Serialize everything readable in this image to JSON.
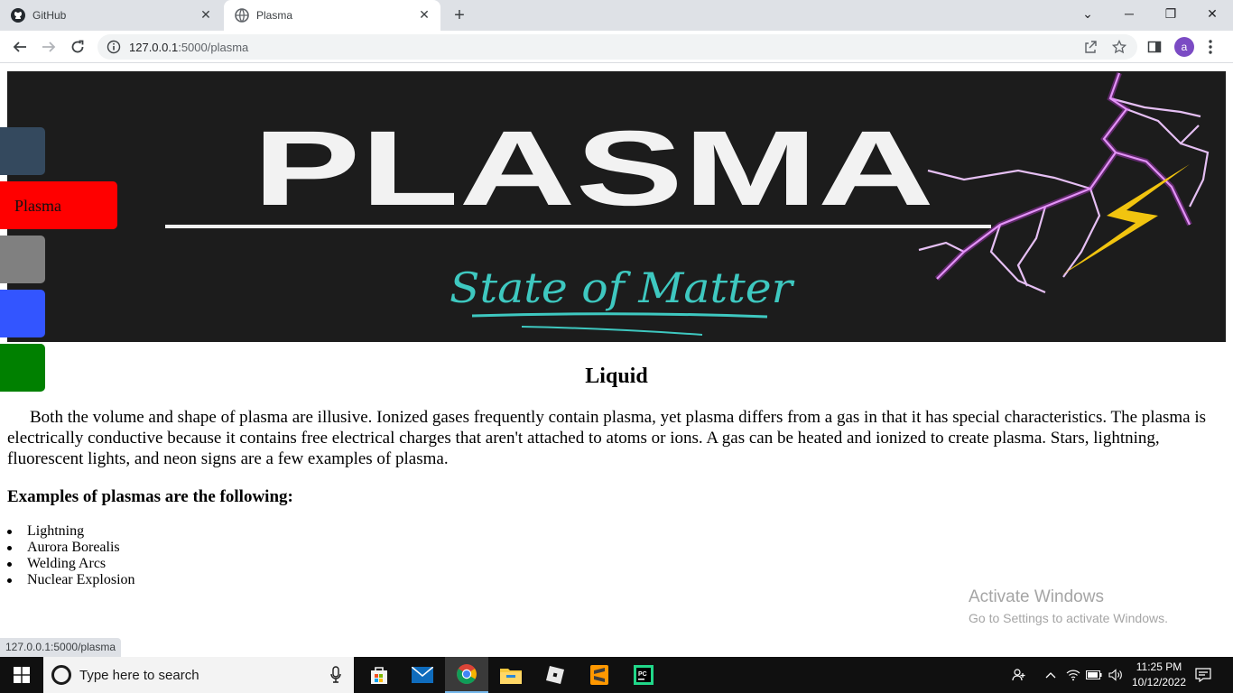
{
  "browser": {
    "tabs": [
      {
        "title": "GitHub",
        "active": false,
        "icon": "github-icon"
      },
      {
        "title": "Plasma",
        "active": true,
        "icon": "globe-icon"
      }
    ],
    "new_tab_label": "+",
    "url_host": "127.0.0.1",
    "url_path": ":5000/plasma",
    "profile_initial": "a",
    "status_url": "127.0.0.1:5000/plasma"
  },
  "banner": {
    "title": "PLASMA",
    "subtitle": "State of Matter"
  },
  "sidebar": {
    "items": [
      {
        "label": "",
        "color": "#34495e"
      },
      {
        "label": "Plasma",
        "color": "#ff0000"
      },
      {
        "label": "",
        "color": "#808080"
      },
      {
        "label": "",
        "color": "#3355ff"
      },
      {
        "label": "",
        "color": "#008000"
      }
    ]
  },
  "content": {
    "heading": "Liquid",
    "paragraph": "Both the volume and shape of plasma are illusive. Ionized gases frequently contain plasma, yet plasma differs from a gas in that it has special characteristics. The plasma is electrically conductive because it contains free electrical charges that aren't attached to atoms or ions. A gas can be heated and ionized to create plasma. Stars, lightning, fluorescent lights, and neon signs are a few examples of plasma.",
    "subheading": "Examples of plasmas are the following:",
    "examples": [
      "Lightning",
      "Aurora Borealis",
      "Welding Arcs",
      "Nuclear Explosion"
    ]
  },
  "watermark": {
    "line1": "Activate Windows",
    "line2": "Go to Settings to activate Windows."
  },
  "taskbar": {
    "search_placeholder": "Type here to search",
    "time": "11:25 PM",
    "date": "10/12/2022"
  }
}
